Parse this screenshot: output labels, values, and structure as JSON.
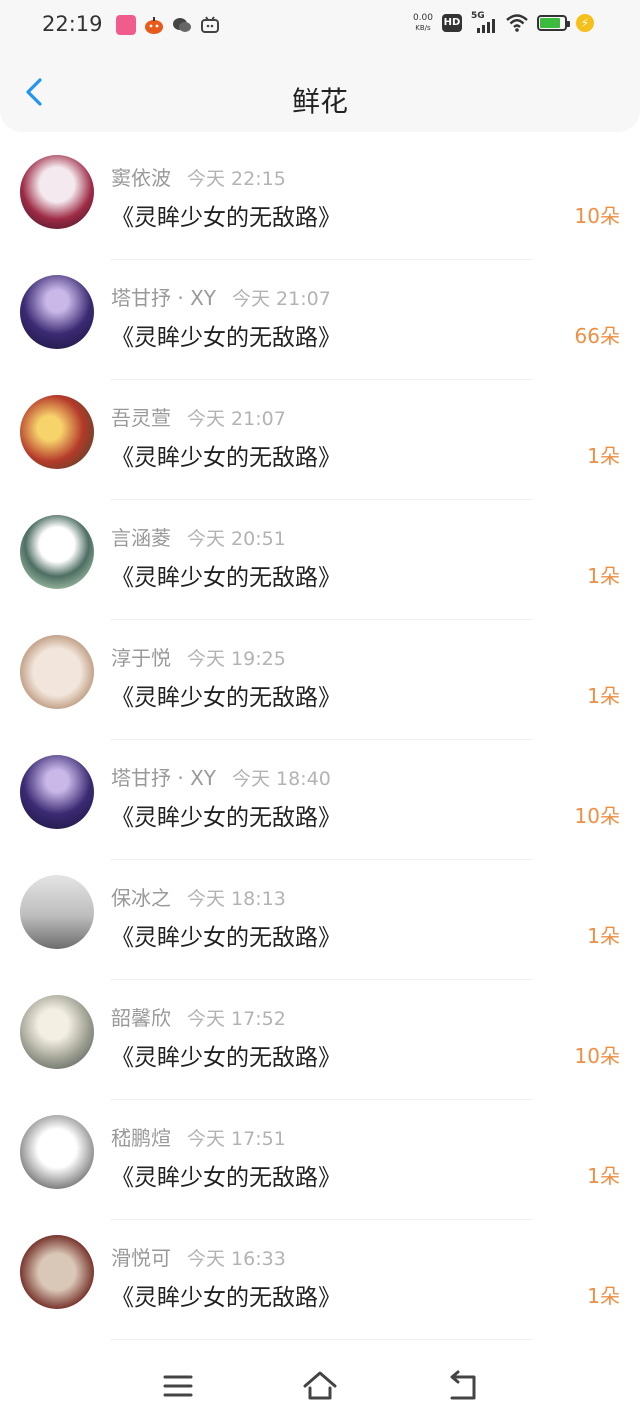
{
  "status_bar": {
    "time": "22:19",
    "net_speed_value": "0.00",
    "net_speed_unit": "KB/s",
    "hd_label": "HD",
    "network_label": "5G",
    "battery_level": 0.85,
    "colors": {
      "battery": "#3dbb3d",
      "charge": "#f5c01a"
    },
    "icons": [
      "gift-app-icon",
      "pumpkin-app-icon",
      "wechat-icon",
      "bilibili-icon",
      "hd-icon",
      "signal-5g-icon",
      "wifi-icon",
      "battery-icon",
      "charging-icon"
    ]
  },
  "header": {
    "title": "鲜花",
    "back_icon": "chevron-left-icon",
    "accent_color": "#2196f3"
  },
  "records": [
    {
      "name": "窦依波",
      "time": "今天 22:15",
      "book": "《灵眸少女的无敌路》",
      "count": "10朵"
    },
    {
      "name": "塔甘抒 · XY",
      "time": "今天 21:07",
      "book": "《灵眸少女的无敌路》",
      "count": "66朵"
    },
    {
      "name": "吾灵萱",
      "time": "今天 21:07",
      "book": "《灵眸少女的无敌路》",
      "count": "1朵"
    },
    {
      "name": "言涵菱",
      "time": "今天 20:51",
      "book": "《灵眸少女的无敌路》",
      "count": "1朵"
    },
    {
      "name": "淳于悦",
      "time": "今天 19:25",
      "book": "《灵眸少女的无敌路》",
      "count": "1朵"
    },
    {
      "name": "塔甘抒 · XY",
      "time": "今天 18:40",
      "book": "《灵眸少女的无敌路》",
      "count": "10朵"
    },
    {
      "name": "保冰之",
      "time": "今天 18:13",
      "book": "《灵眸少女的无敌路》",
      "count": "1朵"
    },
    {
      "name": "韶馨欣",
      "time": "今天 17:52",
      "book": "《灵眸少女的无敌路》",
      "count": "10朵"
    },
    {
      "name": "嵇鹏煊",
      "time": "今天 17:51",
      "book": "《灵眸少女的无敌路》",
      "count": "1朵"
    },
    {
      "name": "滑悦可",
      "time": "今天 16:33",
      "book": "《灵眸少女的无敌路》",
      "count": "1朵"
    }
  ],
  "list_colors": {
    "count": "#ef8f44",
    "name": "#999999",
    "time": "#b3b3b3"
  },
  "nav_bar": {
    "icons": [
      "menu-icon",
      "home-icon",
      "back-icon"
    ]
  }
}
